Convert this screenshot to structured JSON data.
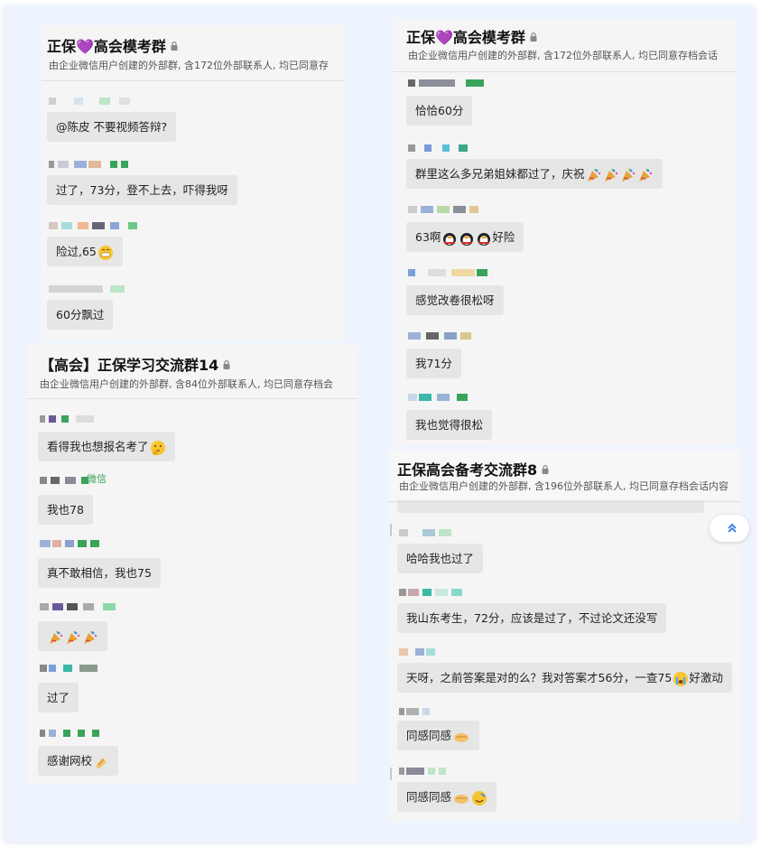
{
  "panels": [
    {
      "title": "正保💜高会模考群",
      "subtitle": "由企业微信用户创建的外部群, 含172位外部联系人, 均已同意存",
      "messages": [
        {
          "text": "@陈皮 不要视频答辩?"
        },
        {
          "text": "过了，73分，登不上去，吓得我呀"
        },
        {
          "text": "险过,65"
        },
        {
          "text": "60分飘过"
        }
      ]
    },
    {
      "title": "正保💜高会模考群",
      "subtitle": "由企业微信用户创建的外部群, 含172位外部联系人, 均已同意存档会话",
      "messages": [
        {
          "text": "恰恰60分"
        },
        {
          "text": "群里这么多兄弟姐妹都过了，庆祝"
        },
        {
          "text": "63啊"
        },
        {
          "text": "感觉改卷很松呀"
        },
        {
          "text": "我71分"
        },
        {
          "text": "我也觉得很松"
        }
      ],
      "extra": {
        "text_after_emoji": "好险"
      }
    },
    {
      "title": "【高会】正保学习交流群14",
      "subtitle": "由企业微信用户创建的外部群, 含84位外部联系人, 均已同意存档会",
      "name_suffix": "微信",
      "messages": [
        {
          "text": "看得我也想报名考了"
        },
        {
          "text": "我也78"
        },
        {
          "text": "真不敢相信，我也75"
        },
        {
          "text": ""
        },
        {
          "text": "过了"
        },
        {
          "text": "感谢网校"
        }
      ]
    },
    {
      "title": "正保高会备考交流群8",
      "subtitle": "由企业微信用户创建的外部群, 含196位外部联系人, 均已同意存档会话内容",
      "messages": [
        {
          "text": "哈哈我也过了"
        },
        {
          "text": "我山东考生，72分，应该是过了，不过论文还没写"
        },
        {
          "text": "天呀，之前答案是对的么？我对答案才56分，一查75"
        },
        {
          "text": "同感同感"
        },
        {
          "text": "同感同感"
        }
      ],
      "extra": {
        "text_after_emoji": "好激动"
      }
    }
  ],
  "icons": {
    "lock": "lock-icon",
    "scroll_up": "double-chevron-up-icon"
  },
  "colors": {
    "background": "#eef4fd",
    "panel": "#f5f5f5",
    "bubble": "#e6e6e6",
    "accent": "#2f7de1"
  }
}
